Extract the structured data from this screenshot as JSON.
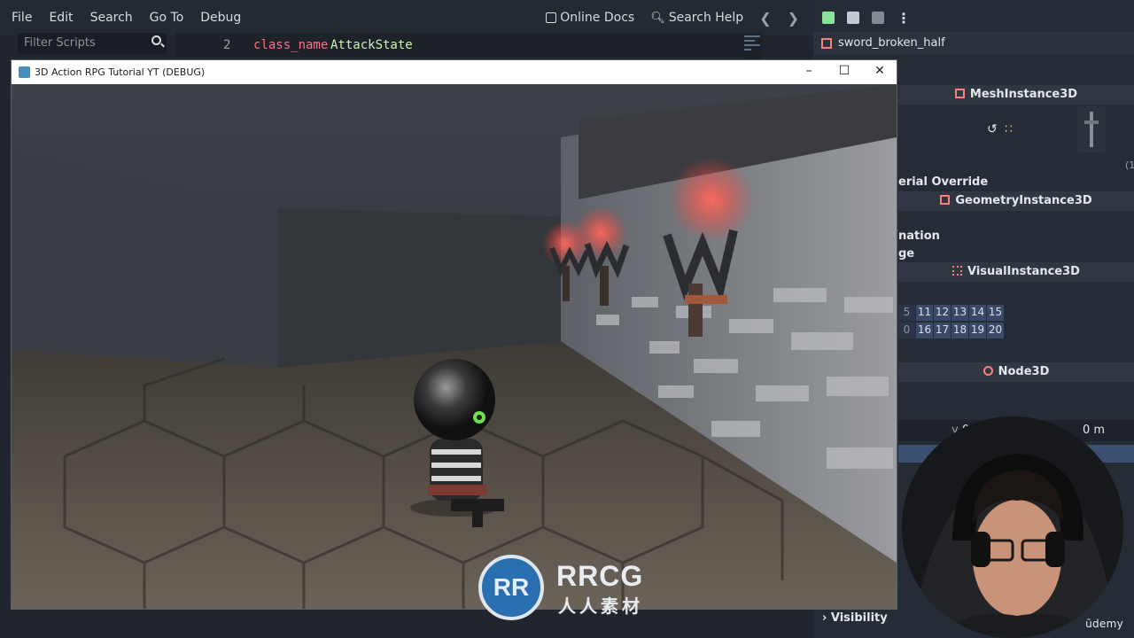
{
  "editor": {
    "menus": [
      "File",
      "Edit",
      "Search",
      "Go To",
      "Debug"
    ],
    "online_docs": "Online Docs",
    "search_help": "Search Help",
    "filter_placeholder": "Filter Scripts",
    "code": {
      "line_number": "2",
      "keyword": "class_name",
      "class_name": "AttackState"
    }
  },
  "dock": {
    "resource_name": "sword_broken_half",
    "sections": {
      "mesh": "MeshInstance3D",
      "geometry": "GeometryInstance3D",
      "visual": "VisualInstance3D",
      "node": "Node3D"
    },
    "props": {
      "material_override": "erial Override",
      "gi": "nation",
      "lod": "ge"
    },
    "layers_row1": [
      "5",
      "11",
      "12",
      "13",
      "14",
      "15"
    ],
    "layers_row2": [
      "0",
      "16",
      "17",
      "18",
      "19",
      "20"
    ],
    "transform_y_label": "y",
    "transform_val": "0",
    "transform_unit": "0 m",
    "visibility": "Visibility",
    "hint_one": "(1"
  },
  "game": {
    "window_title": "3D Action RPG Tutorial YT (DEBUG)"
  },
  "watermark": {
    "logo": "RR",
    "big": "RRCG",
    "small": "人人素材"
  },
  "udemy": "ūdemy"
}
